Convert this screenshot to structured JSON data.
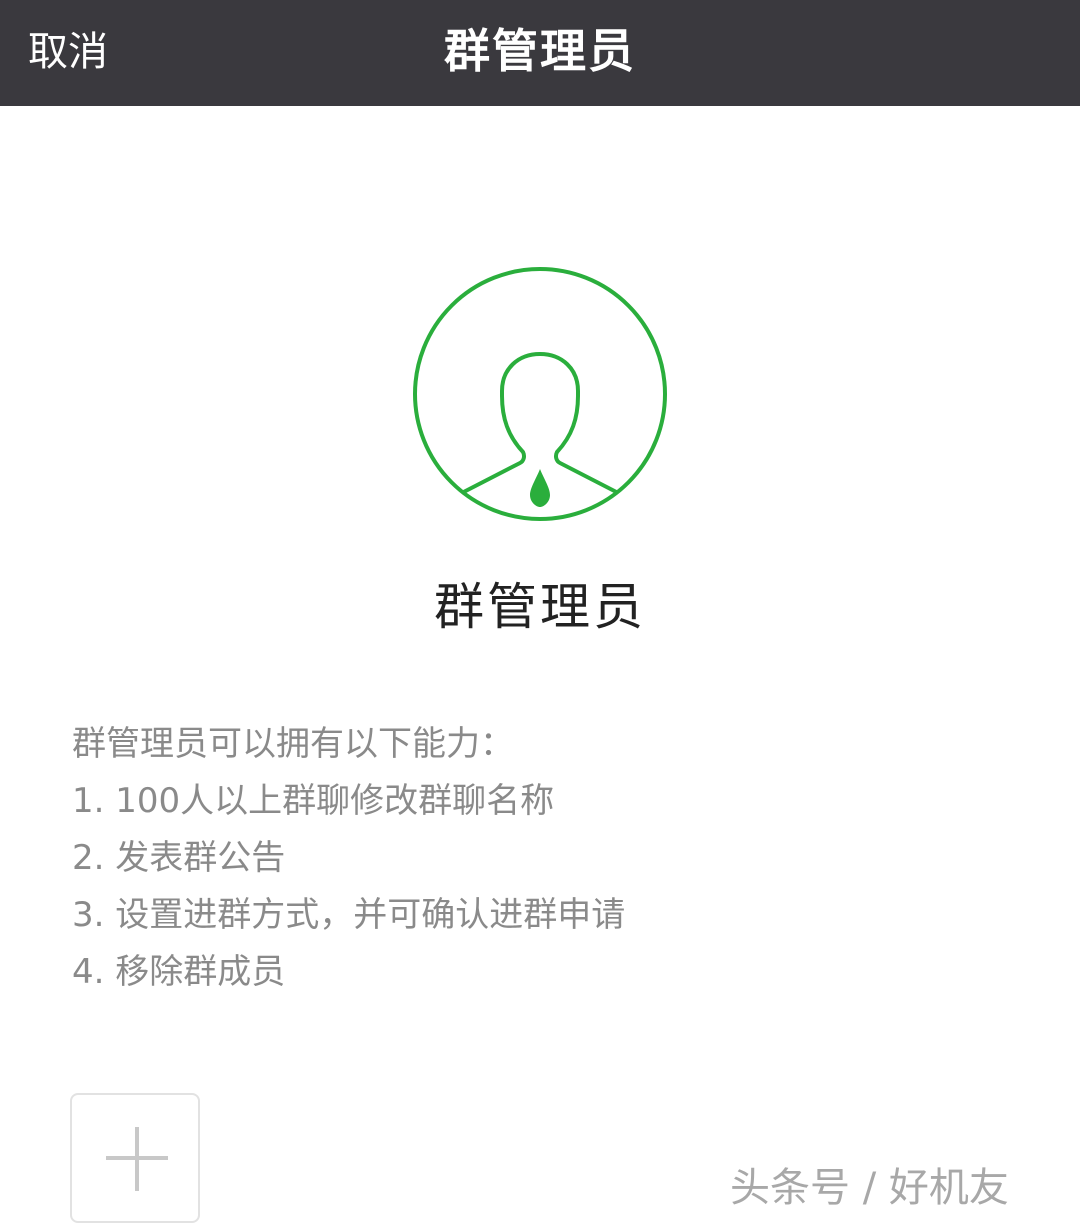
{
  "navbar": {
    "cancel_label": "取消",
    "title": "群管理员"
  },
  "avatar": {
    "icon": "admin-avatar-icon",
    "color": "#2aae3c"
  },
  "role": {
    "title": "群管理员"
  },
  "description": {
    "heading": "群管理员可以拥有以下能力：",
    "items": [
      "1. 100人以上群聊修改群聊名称",
      "2. 发表群公告",
      "3. 设置进群方式，并可确认进群申请",
      "4. 移除群成员"
    ]
  },
  "add_button": {
    "icon": "plus-icon"
  },
  "watermark": {
    "text": "头条号 / 好机友"
  }
}
